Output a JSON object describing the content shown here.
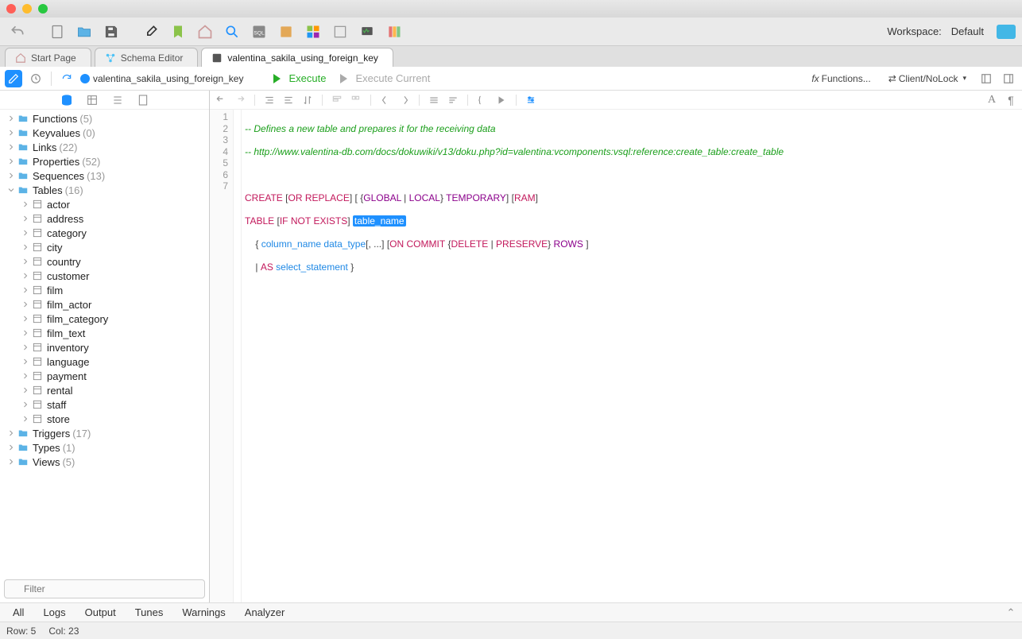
{
  "workspace": {
    "label": "Workspace:",
    "value": "Default"
  },
  "tabs": [
    {
      "label": "Start Page",
      "icon": "home"
    },
    {
      "label": "Schema Editor",
      "icon": "schema"
    },
    {
      "label": "valentina_sakila_using_foreign_key",
      "icon": "sql",
      "active": true
    }
  ],
  "breadcrumb": {
    "db": "valentina_sakila_using_foreign_key"
  },
  "exec": {
    "run": "Execute",
    "runCurrent": "Execute Current"
  },
  "toolbar_right": {
    "functions": "Functions...",
    "lock": "Client/NoLock"
  },
  "tree": {
    "groups": [
      {
        "label": "Functions",
        "count": "(5)"
      },
      {
        "label": "Keyvalues",
        "count": "(0)"
      },
      {
        "label": "Links",
        "count": "(22)"
      },
      {
        "label": "Properties",
        "count": "(52)"
      },
      {
        "label": "Sequences",
        "count": "(13)"
      },
      {
        "label": "Tables",
        "count": "(16)",
        "expanded": true
      },
      {
        "label": "Triggers",
        "count": "(17)"
      },
      {
        "label": "Types",
        "count": "(1)"
      },
      {
        "label": "Views",
        "count": "(5)"
      }
    ],
    "tables": [
      "actor",
      "address",
      "category",
      "city",
      "country",
      "customer",
      "film",
      "film_actor",
      "film_category",
      "film_text",
      "inventory",
      "language",
      "payment",
      "rental",
      "staff",
      "store"
    ]
  },
  "filter": {
    "placeholder": "Filter"
  },
  "code": {
    "l1_comment": "-- Defines a new table and prepares it for the receiving data",
    "l2_comment": "-- http://www.valentina-db.com/docs/dokuwiki/v13/doku.php?id=valentina:vcomponents:vsql:reference:create_table:create_table",
    "create": "CREATE",
    "or": "OR",
    "replace": "REPLACE",
    "global": "GLOBAL",
    "local": "LOCAL",
    "temporary": "TEMPORARY",
    "ram": "RAM",
    "table": "TABLE",
    "if": "IF",
    "not": "NOT",
    "exists": "EXISTS",
    "table_name": "table_name",
    "column_name": "column_name",
    "data_type": "data_type",
    "on": "ON",
    "commit": "COMMIT",
    "delete": "DELETE",
    "preserve": "PRESERVE",
    "rows": "ROWS",
    "as": "AS",
    "select_statement": "select_statement"
  },
  "bottomTabs": [
    "All",
    "Logs",
    "Output",
    "Tunes",
    "Warnings",
    "Analyzer"
  ],
  "status": {
    "row": "Row: 5",
    "col": "Col: 23"
  }
}
